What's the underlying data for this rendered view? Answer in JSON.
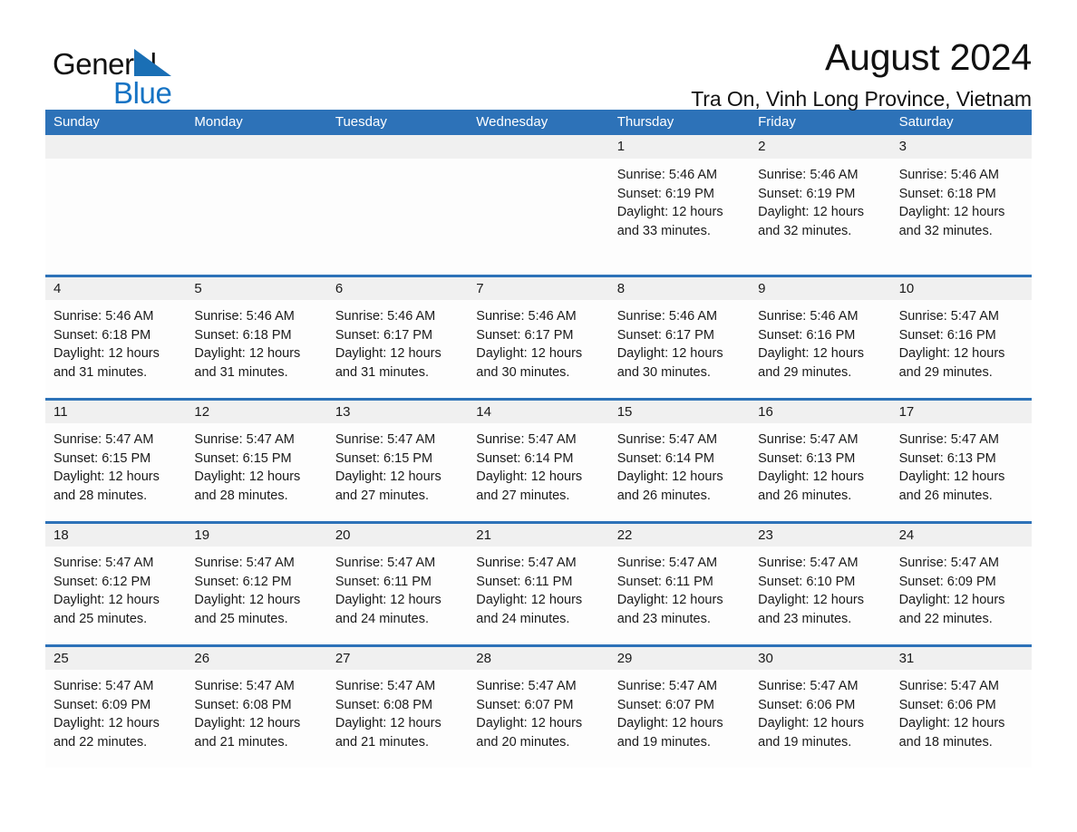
{
  "logo": {
    "word_one": "General",
    "word_two": "Blue",
    "triangle_color": "#1a6fb5",
    "blue_text_color": "#1573c4"
  },
  "header": {
    "month_title": "August 2024",
    "location": "Tra On, Vinh Long Province, Vietnam"
  },
  "theme": {
    "header_blue": "#2d72b8",
    "row_rule_blue": "#2d72b8",
    "daynum_band": "#f0f0f0",
    "cell_background": "#fdfdfd",
    "text": "#1a1a1a"
  },
  "calendar": {
    "weekday_headers": [
      "Sunday",
      "Monday",
      "Tuesday",
      "Wednesday",
      "Thursday",
      "Friday",
      "Saturday"
    ],
    "weeks": [
      {
        "days": [
          {
            "num": "",
            "lines": []
          },
          {
            "num": "",
            "lines": []
          },
          {
            "num": "",
            "lines": []
          },
          {
            "num": "",
            "lines": []
          },
          {
            "num": "1",
            "lines": [
              "Sunrise: 5:46 AM",
              "Sunset: 6:19 PM",
              "Daylight: 12 hours",
              "and 33 minutes."
            ]
          },
          {
            "num": "2",
            "lines": [
              "Sunrise: 5:46 AM",
              "Sunset: 6:19 PM",
              "Daylight: 12 hours",
              "and 32 minutes."
            ]
          },
          {
            "num": "3",
            "lines": [
              "Sunrise: 5:46 AM",
              "Sunset: 6:18 PM",
              "Daylight: 12 hours",
              "and 32 minutes."
            ]
          }
        ]
      },
      {
        "days": [
          {
            "num": "4",
            "lines": [
              "Sunrise: 5:46 AM",
              "Sunset: 6:18 PM",
              "Daylight: 12 hours",
              "and 31 minutes."
            ]
          },
          {
            "num": "5",
            "lines": [
              "Sunrise: 5:46 AM",
              "Sunset: 6:18 PM",
              "Daylight: 12 hours",
              "and 31 minutes."
            ]
          },
          {
            "num": "6",
            "lines": [
              "Sunrise: 5:46 AM",
              "Sunset: 6:17 PM",
              "Daylight: 12 hours",
              "and 31 minutes."
            ]
          },
          {
            "num": "7",
            "lines": [
              "Sunrise: 5:46 AM",
              "Sunset: 6:17 PM",
              "Daylight: 12 hours",
              "and 30 minutes."
            ]
          },
          {
            "num": "8",
            "lines": [
              "Sunrise: 5:46 AM",
              "Sunset: 6:17 PM",
              "Daylight: 12 hours",
              "and 30 minutes."
            ]
          },
          {
            "num": "9",
            "lines": [
              "Sunrise: 5:46 AM",
              "Sunset: 6:16 PM",
              "Daylight: 12 hours",
              "and 29 minutes."
            ]
          },
          {
            "num": "10",
            "lines": [
              "Sunrise: 5:47 AM",
              "Sunset: 6:16 PM",
              "Daylight: 12 hours",
              "and 29 minutes."
            ]
          }
        ]
      },
      {
        "days": [
          {
            "num": "11",
            "lines": [
              "Sunrise: 5:47 AM",
              "Sunset: 6:15 PM",
              "Daylight: 12 hours",
              "and 28 minutes."
            ]
          },
          {
            "num": "12",
            "lines": [
              "Sunrise: 5:47 AM",
              "Sunset: 6:15 PM",
              "Daylight: 12 hours",
              "and 28 minutes."
            ]
          },
          {
            "num": "13",
            "lines": [
              "Sunrise: 5:47 AM",
              "Sunset: 6:15 PM",
              "Daylight: 12 hours",
              "and 27 minutes."
            ]
          },
          {
            "num": "14",
            "lines": [
              "Sunrise: 5:47 AM",
              "Sunset: 6:14 PM",
              "Daylight: 12 hours",
              "and 27 minutes."
            ]
          },
          {
            "num": "15",
            "lines": [
              "Sunrise: 5:47 AM",
              "Sunset: 6:14 PM",
              "Daylight: 12 hours",
              "and 26 minutes."
            ]
          },
          {
            "num": "16",
            "lines": [
              "Sunrise: 5:47 AM",
              "Sunset: 6:13 PM",
              "Daylight: 12 hours",
              "and 26 minutes."
            ]
          },
          {
            "num": "17",
            "lines": [
              "Sunrise: 5:47 AM",
              "Sunset: 6:13 PM",
              "Daylight: 12 hours",
              "and 26 minutes."
            ]
          }
        ]
      },
      {
        "days": [
          {
            "num": "18",
            "lines": [
              "Sunrise: 5:47 AM",
              "Sunset: 6:12 PM",
              "Daylight: 12 hours",
              "and 25 minutes."
            ]
          },
          {
            "num": "19",
            "lines": [
              "Sunrise: 5:47 AM",
              "Sunset: 6:12 PM",
              "Daylight: 12 hours",
              "and 25 minutes."
            ]
          },
          {
            "num": "20",
            "lines": [
              "Sunrise: 5:47 AM",
              "Sunset: 6:11 PM",
              "Daylight: 12 hours",
              "and 24 minutes."
            ]
          },
          {
            "num": "21",
            "lines": [
              "Sunrise: 5:47 AM",
              "Sunset: 6:11 PM",
              "Daylight: 12 hours",
              "and 24 minutes."
            ]
          },
          {
            "num": "22",
            "lines": [
              "Sunrise: 5:47 AM",
              "Sunset: 6:11 PM",
              "Daylight: 12 hours",
              "and 23 minutes."
            ]
          },
          {
            "num": "23",
            "lines": [
              "Sunrise: 5:47 AM",
              "Sunset: 6:10 PM",
              "Daylight: 12 hours",
              "and 23 minutes."
            ]
          },
          {
            "num": "24",
            "lines": [
              "Sunrise: 5:47 AM",
              "Sunset: 6:09 PM",
              "Daylight: 12 hours",
              "and 22 minutes."
            ]
          }
        ]
      },
      {
        "days": [
          {
            "num": "25",
            "lines": [
              "Sunrise: 5:47 AM",
              "Sunset: 6:09 PM",
              "Daylight: 12 hours",
              "and 22 minutes."
            ]
          },
          {
            "num": "26",
            "lines": [
              "Sunrise: 5:47 AM",
              "Sunset: 6:08 PM",
              "Daylight: 12 hours",
              "and 21 minutes."
            ]
          },
          {
            "num": "27",
            "lines": [
              "Sunrise: 5:47 AM",
              "Sunset: 6:08 PM",
              "Daylight: 12 hours",
              "and 21 minutes."
            ]
          },
          {
            "num": "28",
            "lines": [
              "Sunrise: 5:47 AM",
              "Sunset: 6:07 PM",
              "Daylight: 12 hours",
              "and 20 minutes."
            ]
          },
          {
            "num": "29",
            "lines": [
              "Sunrise: 5:47 AM",
              "Sunset: 6:07 PM",
              "Daylight: 12 hours",
              "and 19 minutes."
            ]
          },
          {
            "num": "30",
            "lines": [
              "Sunrise: 5:47 AM",
              "Sunset: 6:06 PM",
              "Daylight: 12 hours",
              "and 19 minutes."
            ]
          },
          {
            "num": "31",
            "lines": [
              "Sunrise: 5:47 AM",
              "Sunset: 6:06 PM",
              "Daylight: 12 hours",
              "and 18 minutes."
            ]
          }
        ]
      }
    ]
  }
}
